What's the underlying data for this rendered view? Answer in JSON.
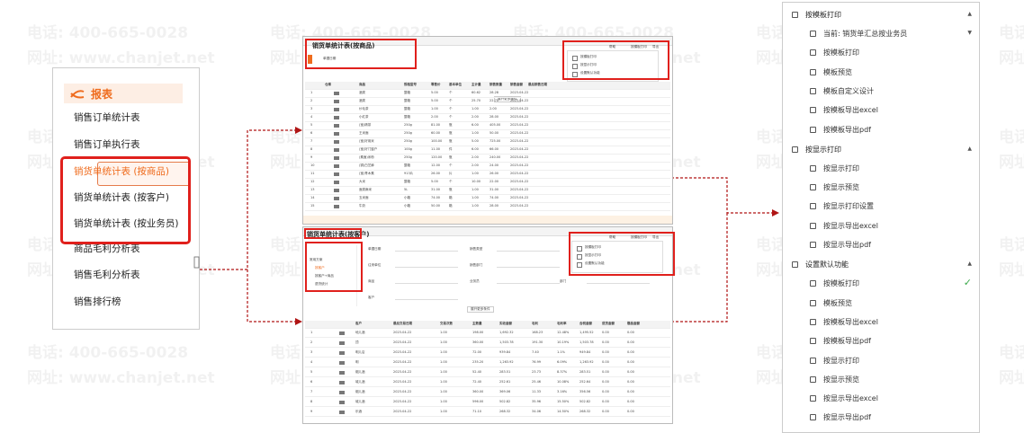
{
  "watermark": {
    "phone": "电话: 400-665-0028",
    "site": "网址: www.chanjet.net"
  },
  "left_menu": {
    "header": "报表",
    "items": [
      {
        "label": "销售订单统计表",
        "active": false
      },
      {
        "label": "销售订单执行表",
        "active": false
      },
      {
        "label": "销货单统计表 (按商品)",
        "active": true
      },
      {
        "label": "销货单统计表 (按客户)",
        "active": false
      },
      {
        "label": "销货单统计表 (按业务员)",
        "active": false
      },
      {
        "label": "商品毛利分析表",
        "active": false
      },
      {
        "label": "销售毛利分析表",
        "active": false
      },
      {
        "label": "销售排行榜",
        "active": false
      }
    ]
  },
  "shot_product": {
    "title": "销货单统计表(按商品)",
    "filter": "单据日期",
    "toolbar": [
      "帮助",
      "按模板打印",
      "导出"
    ],
    "menu": [
      "按模板打印",
      "按显示打印",
      "设置默认功能"
    ],
    "expand": "展开更多条件",
    "columns": [
      "仓库",
      "商品",
      "规格型号",
      "零售价",
      "基本单位",
      "主计量",
      "销售数量",
      "销售金额",
      "最后销售日期"
    ],
    "rows": [
      [
        "1",
        "酒类",
        "整箱",
        "5.00",
        "个",
        "60.62",
        "28.28",
        "2023-04-22"
      ],
      [
        "2",
        "酒类",
        "整箱",
        "5.00",
        "个",
        "25.70",
        "22.70",
        "2023-04-22"
      ],
      [
        "3",
        "炒毛茶",
        "整箱",
        "1.00",
        "个",
        "1.00",
        "2.00",
        "2023-04-22"
      ],
      [
        "4",
        "小红茶",
        "整箱",
        "2.00",
        "个",
        "2.00",
        "28.00",
        "2023-04-22"
      ],
      [
        "5",
        "(宝)精茶",
        "250g",
        "81.00",
        "瓶",
        "6.00",
        "405.00",
        "2023-04-22"
      ],
      [
        "6",
        "王米面",
        "250g",
        "60.00",
        "瓶",
        "1.00",
        "50.00",
        "2023-04-22"
      ],
      [
        "7",
        "(宝)好用米",
        "250g",
        "100.00",
        "瓶",
        "5.00",
        "725.00",
        "2023-04-22"
      ],
      [
        "8",
        "(宝)好门窗户",
        "100g",
        "11.00",
        "件",
        "6.00",
        "66.00",
        "2023-04-22"
      ],
      [
        "9",
        "(素面)米粉",
        "250g",
        "120.00",
        "瓶",
        "2.00",
        "240.00",
        "2023-04-22"
      ],
      [
        "10",
        "(铜)白芝麻",
        "整箱",
        "12.00",
        "个",
        "2.00",
        "24.00",
        "2023-04-22"
      ],
      [
        "11",
        "(宝)青木素",
        "913片",
        "26.00",
        "片",
        "1.00",
        "26.00",
        "2023-04-22"
      ],
      [
        "12",
        "大米",
        "整箱",
        "5.00",
        "个",
        "10.00",
        "22.00",
        "2023-04-22"
      ],
      [
        "13",
        "面类麻米",
        "5L",
        "31.00",
        "瓶",
        "1.00",
        "31.00",
        "2023-04-22"
      ],
      [
        "14",
        "玉米面",
        "小箱",
        "74.00",
        "箱",
        "1.00",
        "74.00",
        "2023-04-22"
      ],
      [
        "15",
        "牛奶",
        "小箱",
        "50.00",
        "箱",
        "1.00",
        "28.00",
        "2023-04-22"
      ]
    ]
  },
  "shot_customer": {
    "title": "销货单统计表(按客户)",
    "left_panel": [
      "常用方案",
      "按客户",
      "按客户+商品",
      "退货统计"
    ],
    "toolbar": [
      "帮助",
      "按模板打印",
      "导出"
    ],
    "menu": [
      "按模板打印",
      "按显示打印",
      "设置默认功能"
    ],
    "fields": [
      "单据日期",
      "销售类型",
      "往来单位",
      "销售部门",
      "商品",
      "业务员",
      "客户",
      "部门"
    ],
    "expand": "展开更多条件",
    "columns": [
      "客户",
      "最后交易日期",
      "交易次数",
      "主数量",
      "实收金额",
      "毛利",
      "毛利率",
      "含税金额",
      "退货金额",
      "赠品金额"
    ],
    "rows": [
      [
        "1",
        "地儿酒",
        "2023-04-22",
        "1.00",
        "198.00",
        "1,692.32",
        "168.23",
        "12.48%",
        "1,495.52",
        "0.00",
        "0.00"
      ],
      [
        "2",
        "顶",
        "2023-04-22",
        "1.00",
        "360.00",
        "1,503.78",
        "191.30",
        "10.19%",
        "1,503.78",
        "0.00",
        "0.00"
      ],
      [
        "3",
        "明儿店",
        "2023-04-22",
        "1.00",
        "72.00",
        "939.84",
        "7.40",
        "1.1%",
        "949.84",
        "0.00",
        "0.00"
      ],
      [
        "4",
        "明",
        "2023-04-22",
        "1.00",
        "235.20",
        "1,263.92",
        "76.99",
        "6.09%",
        "1,263.92",
        "0.00",
        "0.00"
      ],
      [
        "5",
        "烟儿酒",
        "2023-04-22",
        "1.00",
        "52.40",
        "283.51",
        "23.73",
        "8.37%",
        "283.51",
        "0.00",
        "0.00"
      ],
      [
        "6",
        "城儿酒",
        "2023-04-22",
        "1.00",
        "72.40",
        "252.61",
        "25.46",
        "10.08%",
        "252.64",
        "0.00",
        "0.00"
      ],
      [
        "7",
        "烟儿酒",
        "2023-04-22",
        "1.00",
        "360.00",
        "369.06",
        "11.33",
        "3.16%",
        "356.56",
        "0.00",
        "0.00"
      ],
      [
        "8",
        "城儿酒",
        "2023-04-22",
        "1.00",
        "596.00",
        "502.82",
        "35.96",
        "15.50%",
        "502.82",
        "0.00",
        "0.00"
      ],
      [
        "9",
        "乐酒",
        "2023-04-22",
        "1.00",
        "71.10",
        "268.32",
        "34.06",
        "14.50%",
        "268.32",
        "0.00",
        "0.00"
      ]
    ]
  },
  "right_menu": {
    "sections": [
      {
        "title": "按模板打印",
        "items": [
          "当前: 销货单汇总按业务员",
          "按模板打印",
          "模板预览",
          "模板自定义设计",
          "按模板导出excel",
          "按模板导出pdf"
        ]
      },
      {
        "title": "按显示打印",
        "items": [
          "按显示打印",
          "按显示预览",
          "按显示打印设置",
          "按显示导出excel",
          "按显示导出pdf"
        ]
      },
      {
        "title": "设置默认功能",
        "items": [
          "按模板打印",
          "模板预览",
          "按模板导出excel",
          "按模板导出pdf",
          "按显示打印",
          "按显示预览",
          "按显示导出excel",
          "按显示导出pdf"
        ]
      }
    ],
    "checked_item": "按模板打印"
  },
  "colors": {
    "accent": "#ef6c1e",
    "highlight": "#e0201c",
    "arrow": "#b01515",
    "check": "#3aa84a"
  }
}
